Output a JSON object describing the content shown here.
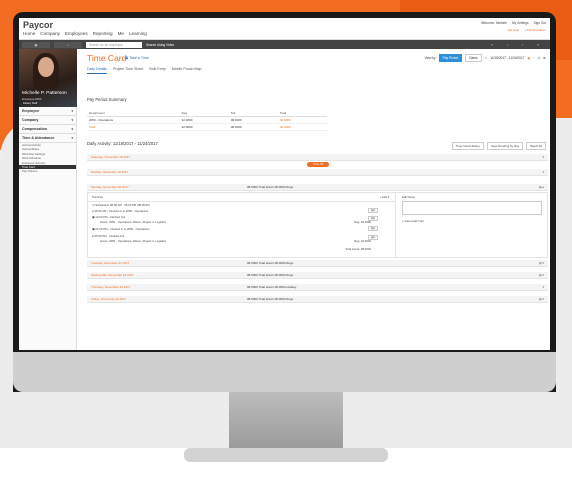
{
  "app": {
    "logo": "Paycor",
    "nav": [
      "Home",
      "Company",
      "Employees",
      "Reporting",
      "Me",
      "Learning"
    ],
    "top_links": [
      "Welcome, Michele",
      "My Settings",
      "Sign Out"
    ],
    "top_links2": [
      "Get Help",
      "Help Dropdown"
    ],
    "toolbar": {
      "search_placeholder": "Search for an employee",
      "learning": "Search Using Video"
    }
  },
  "employee": {
    "name": "Michelle P. Patterson",
    "id": "Employee #103",
    "tag": "Dietary Staff"
  },
  "sidebar": {
    "sections": [
      "Employee",
      "Company",
      "Compensation",
      "Time & Attendance"
    ],
    "items": [
      "Accrual Activity",
      "Accrual Rules",
      "Work Day Settings",
      "Work Schedule",
      "Employee Security",
      "Time Card",
      "Pay Policies"
    ],
    "active_index": 5
  },
  "page": {
    "title": "Time Card",
    "take_photo": "Take a Time",
    "view_by_label": "View by",
    "view_by": [
      "Pay Period",
      "Dates"
    ],
    "date_range": "11/18/2017 - 11/24/2017",
    "tabs": [
      "Daily Details",
      "Project Time Sheet",
      "Bulk Entry",
      "Mobile Punch Map"
    ],
    "active_tab": 0
  },
  "summary": {
    "heading": "Pay Period Summary",
    "columns": [
      "Department",
      "Reg",
      "Std",
      "Total"
    ],
    "rows": [
      [
        "2050 - Operations",
        "32.0000",
        "08.0000",
        "40.0000"
      ],
      [
        "Total",
        "32.0000",
        "08.0000",
        "40.0000"
      ]
    ]
  },
  "daily": {
    "heading": "Daily Activity: 11/18/2017 - 11/24/2017",
    "buttons": [
      "Time Card History",
      "View Pending by Day",
      "Batch All"
    ],
    "chip": "Time Off"
  },
  "days": [
    {
      "label": "Saturday, November 18 2017",
      "total": ""
    },
    {
      "label": "Sunday, November 19 2017",
      "total": ""
    },
    {
      "label": "Monday, November 20 2017",
      "total": "08.0000 Total Hours 08.0000 Regs"
    },
    {
      "label": "Tuesday, November 21 2017",
      "total": "08.0000 Total Hours 08.0000 Regs"
    },
    {
      "label": "Wednesday, November 22 2017",
      "total": "08.0000 Total Hours 08.0000 Regs"
    },
    {
      "label": "Thursday, November 23 2017",
      "total": "08.0000 Total Hours 08.0000 Holiday"
    },
    {
      "label": "Friday, November 24 2017",
      "total": "08.0000 Total Hours 08.0000 Regs"
    }
  ],
  "detail": {
    "heading": "Punches",
    "add": "Add",
    "events": [
      "Scheduled: 08:00 AM - 05:00 PM (08:00/00)",
      "08:00 AM - Clocked In to 2050 - Operations",
      "12:00 PM - Clocked Out",
      "01:00 PM - Clocked In to 2050 - Operations",
      "05:00 PM - Clocked Out"
    ],
    "hours": [
      "Hours: 2050 - Operations, Allison, Project 4, Logistics",
      "Hours: 2050 - Operations, Allison, Project 4, Logistics"
    ],
    "regs": [
      "Reg: 04.0000",
      "Reg: 04.0000"
    ],
    "total": "Total Hours: 08.0000",
    "note_label": "Edit Notes",
    "audit": "View Audit Trail"
  }
}
